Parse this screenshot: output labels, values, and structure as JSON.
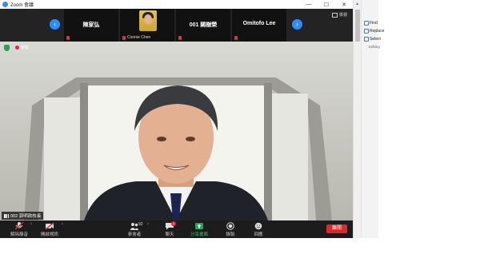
{
  "window": {
    "title": "Zoom 會議",
    "minimize": "—",
    "maximize": "☐",
    "close": "✕"
  },
  "gallery": {
    "prev_label": "‹",
    "next_label": "›",
    "tiles": [
      {
        "name": "陳家弘"
      },
      {
        "name": "Connie Chen"
      },
      {
        "name": "001 闕樹榮"
      },
      {
        "name": "Omitofo Lee"
      }
    ],
    "view_label": "檢視"
  },
  "main": {
    "recording_label": "錄製",
    "speaker_label": "002 郭明政校長"
  },
  "toolbar": {
    "unmute": "解除靜音",
    "start_video": "開啟視訊",
    "participants": "參會者",
    "participants_count": "92",
    "chat": "聊天",
    "chat_badge": "1",
    "share": "分享畫面",
    "record": "錄製",
    "reactions": "回應",
    "leave": "離開"
  },
  "word_ribbon": {
    "items": [
      "Find",
      "Replace",
      "Select"
    ],
    "group_label": "Editing"
  }
}
